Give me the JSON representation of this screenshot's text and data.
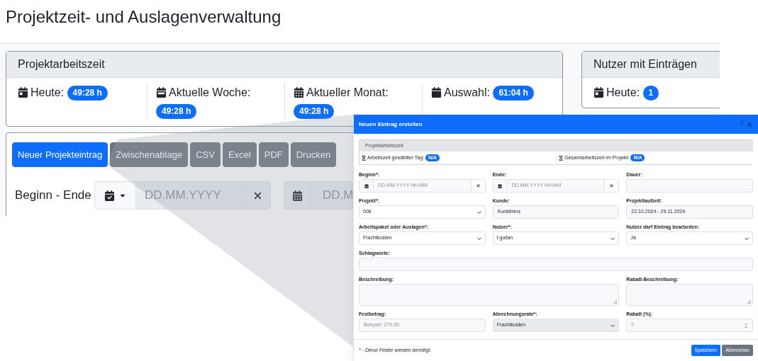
{
  "page": {
    "title": "Projektzeit- und Auslagenverwaltung"
  },
  "summary_card": {
    "title": "Projektarbeitszeit",
    "stats": [
      {
        "label": "Heute:",
        "badge": "49:28 h"
      },
      {
        "label": "Aktuelle Woche:",
        "badge": "49:28 h"
      },
      {
        "label": "Aktueller Monat:",
        "badge": "49:28 h"
      },
      {
        "label": "Auswahl:",
        "badge": "61:04 h"
      }
    ]
  },
  "users_card": {
    "title": "Nutzer mit Einträgen",
    "stats": [
      {
        "label": "Heute:",
        "badge": "1"
      }
    ]
  },
  "toolbar": {
    "buttons": [
      {
        "label": "Neuer Projekteintrag",
        "kind": "primary"
      },
      {
        "label": "Zwischenablage",
        "kind": "secondary"
      },
      {
        "label": "CSV",
        "kind": "secondary"
      },
      {
        "label": "Excel",
        "kind": "secondary"
      },
      {
        "label": "PDF",
        "kind": "secondary"
      },
      {
        "label": "Drucken",
        "kind": "secondary"
      }
    ]
  },
  "filter": {
    "label": "Beginn - Ende",
    "start_placeholder": "DD.MM.YYYY",
    "end_placeholder": "DD.M"
  },
  "dialog": {
    "title": "Neuen Eintrag erstellen",
    "help": "?",
    "info_card": {
      "title": "Projektarbeitszeit",
      "stats": [
        {
          "label": "Arbeitszeit gewählter Tag:",
          "badge": "N/A"
        },
        {
          "label": "Gesamtarbeitszeit im Projekt:",
          "badge": "N/A"
        }
      ]
    },
    "rows": [
      [
        {
          "label": "Beginn*:",
          "kind": "datetime",
          "placeholder": "DD.MM.YYYY HH:MM"
        },
        {
          "label": "Ende:",
          "kind": "datetime",
          "placeholder": "DD.MM.YYYY HH:MM"
        },
        {
          "label": "Dauer:",
          "kind": "readonly"
        }
      ],
      [
        {
          "label": "Projekt*:",
          "kind": "select",
          "value": "006",
          "disabled": false
        },
        {
          "label": "Kunde:",
          "kind": "readonly",
          "value": "KunstHerz"
        },
        {
          "label": "Projektlaufzeit:",
          "kind": "readonly",
          "value": "22.10.2024 - 29.11.2024"
        }
      ],
      [
        {
          "label": "Arbeitspaket oder Auslagen*:",
          "kind": "select",
          "value": "Frachtkosten",
          "disabled": false
        },
        {
          "label": "Nutzer*:",
          "kind": "select",
          "value": "f.gollan",
          "disabled": false
        },
        {
          "label": "Nutzer darf Eintrag bearbeiten:",
          "kind": "select",
          "value": "Ja",
          "disabled": false
        }
      ],
      [
        {
          "label": "Schlagworte:",
          "kind": "readonly"
        }
      ],
      [
        {
          "label": "Beschreibung:",
          "kind": "textarea"
        },
        "",
        {
          "label": "Rabatt-Beschreibung:",
          "kind": "textarea"
        }
      ],
      [
        {
          "label": "Festbetrag:",
          "kind": "text",
          "placeholder": "Beispiel: 279,35"
        },
        {
          "label": "Abrechnungsrate*:",
          "kind": "select",
          "value": "Frachtkosten",
          "disabled": true
        },
        {
          "label": "Rabatt (%):",
          "kind": "number",
          "placeholder": "0"
        }
      ]
    ],
    "footer_note": "* - Diese Felder werden benötigt.",
    "buttons": [
      {
        "label": "Speichern",
        "kind": "primary"
      },
      {
        "label": "Abbrechen",
        "kind": "secondary"
      }
    ]
  }
}
